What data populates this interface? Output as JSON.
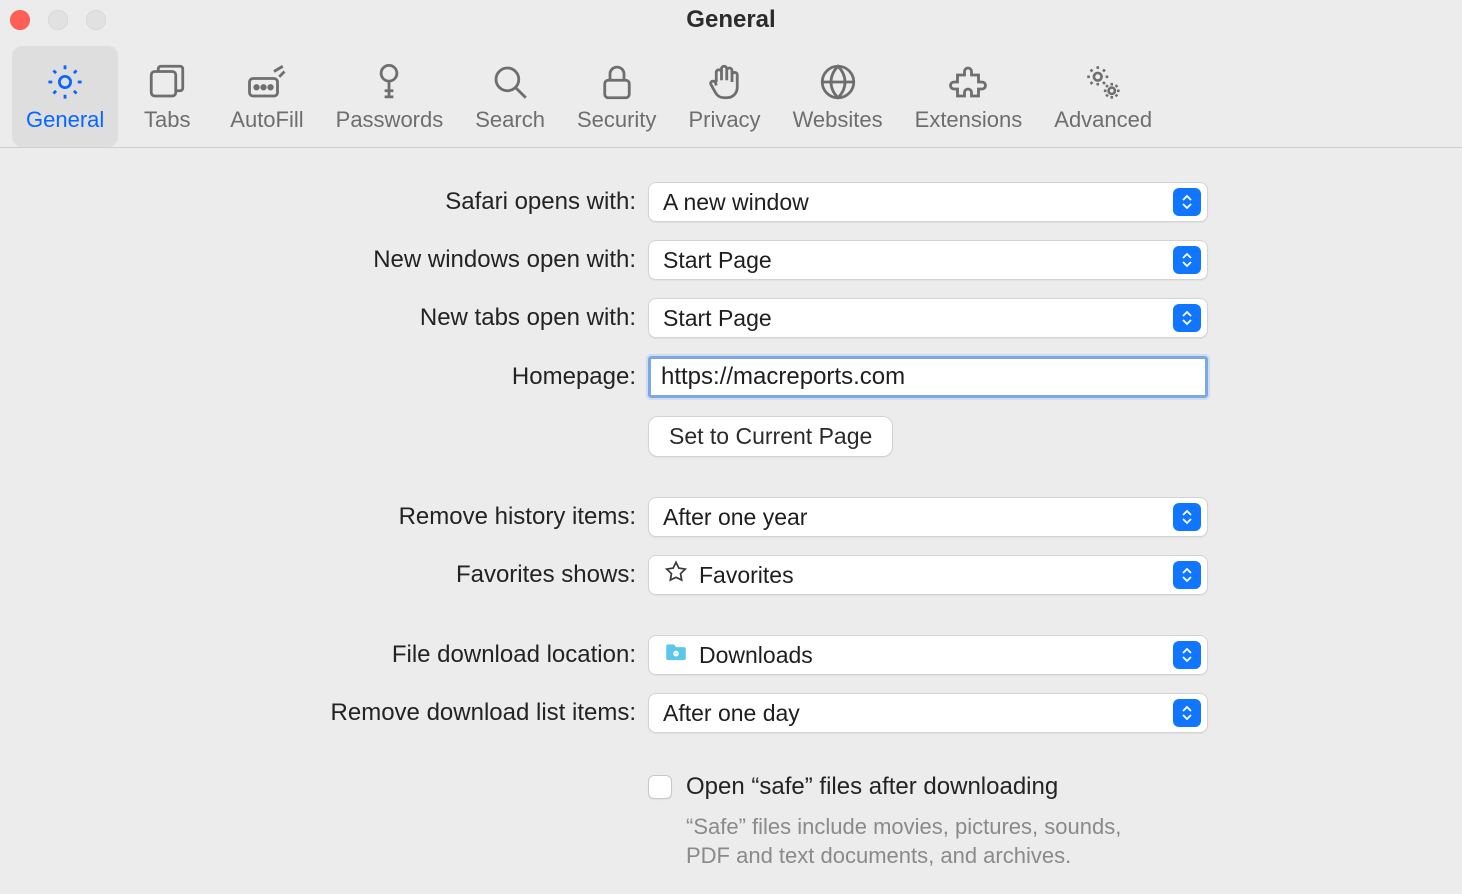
{
  "window": {
    "title": "General"
  },
  "toolbar": {
    "items": [
      {
        "id": "general",
        "label": "General",
        "active": true
      },
      {
        "id": "tabs",
        "label": "Tabs",
        "active": false
      },
      {
        "id": "autofill",
        "label": "AutoFill",
        "active": false
      },
      {
        "id": "passwords",
        "label": "Passwords",
        "active": false
      },
      {
        "id": "search",
        "label": "Search",
        "active": false
      },
      {
        "id": "security",
        "label": "Security",
        "active": false
      },
      {
        "id": "privacy",
        "label": "Privacy",
        "active": false
      },
      {
        "id": "websites",
        "label": "Websites",
        "active": false
      },
      {
        "id": "extensions",
        "label": "Extensions",
        "active": false
      },
      {
        "id": "advanced",
        "label": "Advanced",
        "active": false
      }
    ]
  },
  "settings": {
    "safari_opens_with": {
      "label": "Safari opens with:",
      "value": "A new window"
    },
    "new_windows": {
      "label": "New windows open with:",
      "value": "Start Page"
    },
    "new_tabs": {
      "label": "New tabs open with:",
      "value": "Start Page"
    },
    "homepage": {
      "label": "Homepage:",
      "value": "https://macreports.com"
    },
    "set_current_page": {
      "label": "Set to Current Page"
    },
    "remove_history": {
      "label": "Remove history items:",
      "value": "After one year"
    },
    "favorites_shows": {
      "label": "Favorites shows:",
      "value": "Favorites"
    },
    "download_location": {
      "label": "File download location:",
      "value": "Downloads"
    },
    "remove_downloads": {
      "label": "Remove download list items:",
      "value": "After one day"
    },
    "open_safe": {
      "label": "Open “safe” files after downloading",
      "checked": false,
      "help": "“Safe” files include movies, pictures, sounds, PDF and text documents, and archives."
    }
  }
}
